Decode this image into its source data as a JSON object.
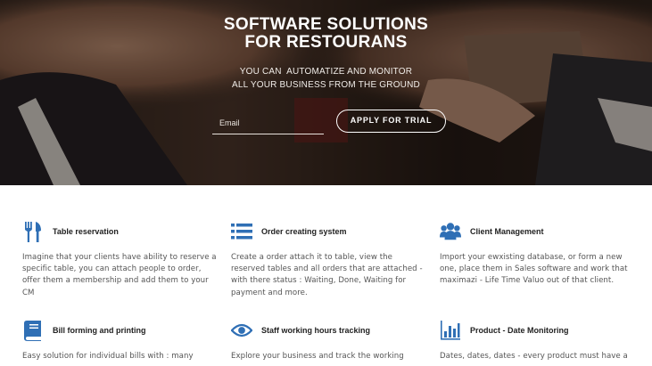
{
  "hero": {
    "title_line1": "SOFTWARE SOLUTIONS",
    "title_line2": "FOR RESTOURANS",
    "subtitle_line1": "YOU CAN  AUTOMATIZE AND MONITOR",
    "subtitle_line2": "ALL YOUR BUSINESS FROM THE GROUND",
    "email_placeholder": "Email",
    "cta_label": "APPLY FOR TRIAL"
  },
  "colors": {
    "accent_blue": "#2f6fb5",
    "hero_overlay": "#1a120e",
    "text_dark": "#222222"
  },
  "features": [
    {
      "icon": "fork-knife-icon",
      "title": "Table reservation",
      "description": "Imagine that your clients have ability to reserve a specific table, you can attach people to order, offer them a membership and add them to your CM"
    },
    {
      "icon": "list-icon",
      "title": "Order creating system",
      "description": "Create a order attach it to table, view the reserved tables and all orders that are attached - with there status : Waiting, Done, Waiting for payment and more."
    },
    {
      "icon": "users-icon",
      "title": "Client Management",
      "description": "Import your ewxisting database, or form a new one, place them in Sales software and work that maximazi - Life Time Valuo out of that client."
    },
    {
      "icon": "book-icon",
      "title": "Bill forming and printing",
      "description": "Easy solution for individual bills with : many"
    },
    {
      "icon": "eye-icon",
      "title": "Staff working hours tracking",
      "description": "Explore your business and track the working"
    },
    {
      "icon": "bar-chart-icon",
      "title": "Product - Date Monitoring",
      "description": "Dates, dates, dates - every product must have a"
    }
  ]
}
